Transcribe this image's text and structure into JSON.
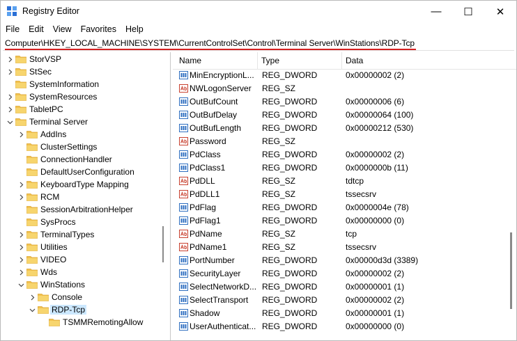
{
  "window": {
    "title": "Registry Editor",
    "controls": {
      "minimize": "—",
      "maximize": "☐",
      "close": "✕"
    }
  },
  "menu": [
    "File",
    "Edit",
    "View",
    "Favorites",
    "Help"
  ],
  "address": "Computer\\HKEY_LOCAL_MACHINE\\SYSTEM\\CurrentControlSet\\Control\\Terminal Server\\WinStations\\RDP-Tcp",
  "colors": {
    "folder": "#f2c14e",
    "folder_dark": "#dca632",
    "selection": "#cce8ff",
    "highlight_underline": "#d52020",
    "dword_icon": "#2f6fc0",
    "sz_icon": "#c8402f"
  },
  "tree": [
    {
      "label": "StorVSP",
      "level": 1,
      "state": "collapsed"
    },
    {
      "label": "StSec",
      "level": 1,
      "state": "collapsed"
    },
    {
      "label": "SystemInformation",
      "level": 1,
      "state": "leaf"
    },
    {
      "label": "SystemResources",
      "level": 1,
      "state": "collapsed"
    },
    {
      "label": "TabletPC",
      "level": 1,
      "state": "collapsed"
    },
    {
      "label": "Terminal Server",
      "level": 1,
      "state": "expanded"
    },
    {
      "label": "AddIns",
      "level": 2,
      "state": "collapsed"
    },
    {
      "label": "ClusterSettings",
      "level": 2,
      "state": "leaf"
    },
    {
      "label": "ConnectionHandler",
      "level": 2,
      "state": "leaf"
    },
    {
      "label": "DefaultUserConfiguration",
      "level": 2,
      "state": "leaf"
    },
    {
      "label": "KeyboardType Mapping",
      "level": 2,
      "state": "collapsed"
    },
    {
      "label": "RCM",
      "level": 2,
      "state": "collapsed"
    },
    {
      "label": "SessionArbitrationHelper",
      "level": 2,
      "state": "leaf"
    },
    {
      "label": "SysProcs",
      "level": 2,
      "state": "leaf"
    },
    {
      "label": "TerminalTypes",
      "level": 2,
      "state": "collapsed"
    },
    {
      "label": "Utilities",
      "level": 2,
      "state": "collapsed"
    },
    {
      "label": "VIDEO",
      "level": 2,
      "state": "collapsed"
    },
    {
      "label": "Wds",
      "level": 2,
      "state": "collapsed"
    },
    {
      "label": "WinStations",
      "level": 2,
      "state": "expanded"
    },
    {
      "label": "Console",
      "level": 3,
      "state": "collapsed"
    },
    {
      "label": "RDP-Tcp",
      "level": 3,
      "state": "expanded",
      "selected": true
    },
    {
      "label": "TSMMRemotingAllow",
      "level": 4,
      "state": "leaf"
    }
  ],
  "columns": {
    "name": "Name",
    "type": "Type",
    "data": "Data"
  },
  "values": [
    {
      "name": "MinEncryptionL...",
      "type": "REG_DWORD",
      "data": "0x00000002 (2)",
      "icon": "dword-icon"
    },
    {
      "name": "NWLogonServer",
      "type": "REG_SZ",
      "data": "",
      "icon": "string-icon"
    },
    {
      "name": "OutBufCount",
      "type": "REG_DWORD",
      "data": "0x00000006 (6)",
      "icon": "dword-icon"
    },
    {
      "name": "OutBufDelay",
      "type": "REG_DWORD",
      "data": "0x00000064 (100)",
      "icon": "dword-icon"
    },
    {
      "name": "OutBufLength",
      "type": "REG_DWORD",
      "data": "0x00000212 (530)",
      "icon": "dword-icon"
    },
    {
      "name": "Password",
      "type": "REG_SZ",
      "data": "",
      "icon": "string-icon"
    },
    {
      "name": "PdClass",
      "type": "REG_DWORD",
      "data": "0x00000002 (2)",
      "icon": "dword-icon"
    },
    {
      "name": "PdClass1",
      "type": "REG_DWORD",
      "data": "0x0000000b (11)",
      "icon": "dword-icon"
    },
    {
      "name": "PdDLL",
      "type": "REG_SZ",
      "data": "tdtcp",
      "icon": "string-icon"
    },
    {
      "name": "PdDLL1",
      "type": "REG_SZ",
      "data": "tssecsrv",
      "icon": "string-icon"
    },
    {
      "name": "PdFlag",
      "type": "REG_DWORD",
      "data": "0x0000004e (78)",
      "icon": "dword-icon"
    },
    {
      "name": "PdFlag1",
      "type": "REG_DWORD",
      "data": "0x00000000 (0)",
      "icon": "dword-icon"
    },
    {
      "name": "PdName",
      "type": "REG_SZ",
      "data": "tcp",
      "icon": "string-icon"
    },
    {
      "name": "PdName1",
      "type": "REG_SZ",
      "data": "tssecsrv",
      "icon": "string-icon"
    },
    {
      "name": "PortNumber",
      "type": "REG_DWORD",
      "data": "0x00000d3d (3389)",
      "icon": "dword-icon"
    },
    {
      "name": "SecurityLayer",
      "type": "REG_DWORD",
      "data": "0x00000002 (2)",
      "icon": "dword-icon"
    },
    {
      "name": "SelectNetworkD...",
      "type": "REG_DWORD",
      "data": "0x00000001 (1)",
      "icon": "dword-icon"
    },
    {
      "name": "SelectTransport",
      "type": "REG_DWORD",
      "data": "0x00000002 (2)",
      "icon": "dword-icon"
    },
    {
      "name": "Shadow",
      "type": "REG_DWORD",
      "data": "0x00000001 (1)",
      "icon": "dword-icon"
    },
    {
      "name": "UserAuthenticat...",
      "type": "REG_DWORD",
      "data": "0x00000000 (0)",
      "icon": "dword-icon"
    }
  ]
}
